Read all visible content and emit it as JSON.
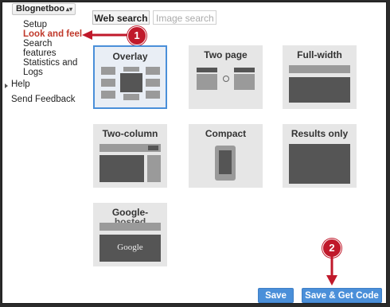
{
  "sidebar": {
    "site_select": "Blognetboo",
    "items": [
      {
        "label": "Setup"
      },
      {
        "label": "Look and feel"
      },
      {
        "label": "Search"
      },
      {
        "label": "features"
      },
      {
        "label": "Statistics and"
      },
      {
        "label": "Logs"
      },
      {
        "label": "Help"
      },
      {
        "label": "Send Feedback"
      }
    ]
  },
  "tabs": {
    "web_search": "Web search",
    "image_search": "Image search"
  },
  "layouts": [
    {
      "label": "Overlay",
      "selected": true
    },
    {
      "label": "Two page"
    },
    {
      "label": "Full-width"
    },
    {
      "label": "Two-column"
    },
    {
      "label": "Compact"
    },
    {
      "label": "Results only"
    },
    {
      "label": "Google-hosted",
      "label_visible": "Google-",
      "label_cut": "hosted"
    }
  ],
  "google_logo_text": "Google",
  "buttons": {
    "save": "Save",
    "save_get_code": "Save & Get Code"
  },
  "annotations": {
    "step1": "1",
    "step2": "2",
    "accent": "#c0192b"
  }
}
